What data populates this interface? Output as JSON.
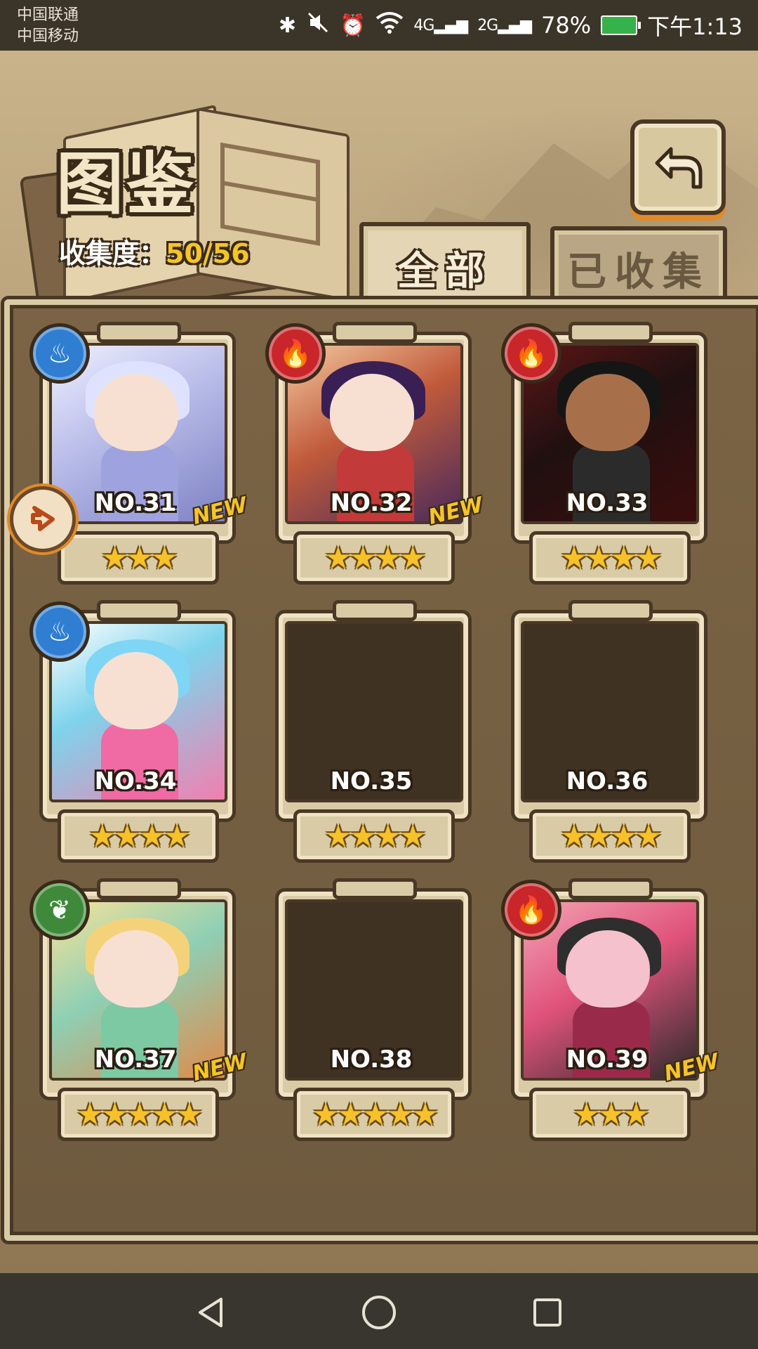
{
  "status_bar": {
    "carrier_1": "中国联通",
    "carrier_2": "中国移动",
    "signal_1": "4G",
    "signal_2": "2G",
    "battery": "78%",
    "time": "下午1:13",
    "icons": [
      "bluetooth-icon",
      "mute-icon",
      "alarm-icon",
      "wifi-icon"
    ]
  },
  "header": {
    "title": "图鉴",
    "collect_label": "收集度：",
    "collect_value": "50/56",
    "back_icon": "return-arrow-icon"
  },
  "tabs": [
    {
      "label": "全部",
      "active": true
    },
    {
      "label": "已收集",
      "active": false
    }
  ],
  "cards": [
    {
      "no": "NO.31",
      "element": "water",
      "stars": "★★★",
      "is_new": true,
      "owned": true
    },
    {
      "no": "NO.32",
      "element": "fire",
      "stars": "★★★★",
      "is_new": true,
      "owned": true
    },
    {
      "no": "NO.33",
      "element": "fire",
      "stars": "★★★★",
      "is_new": false,
      "owned": true
    },
    {
      "no": "NO.34",
      "element": "water",
      "stars": "★★★★",
      "is_new": false,
      "owned": true
    },
    {
      "no": "NO.35",
      "element": "",
      "stars": "★★★★",
      "is_new": false,
      "owned": false
    },
    {
      "no": "NO.36",
      "element": "",
      "stars": "★★★★",
      "is_new": false,
      "owned": false
    },
    {
      "no": "NO.37",
      "element": "wood",
      "stars": "★★★★★",
      "is_new": true,
      "owned": true
    },
    {
      "no": "NO.38",
      "element": "",
      "stars": "★★★★★",
      "is_new": false,
      "owned": false
    },
    {
      "no": "NO.39",
      "element": "fire",
      "stars": "★★★",
      "is_new": true,
      "owned": true
    }
  ],
  "new_tag": "NEW",
  "element_colors": {
    "water": "#2f7ed2",
    "fire": "#c8262a",
    "wood": "#3f8a3a"
  },
  "nav": [
    "back-triangle-icon",
    "home-circle-icon",
    "recents-square-icon"
  ]
}
